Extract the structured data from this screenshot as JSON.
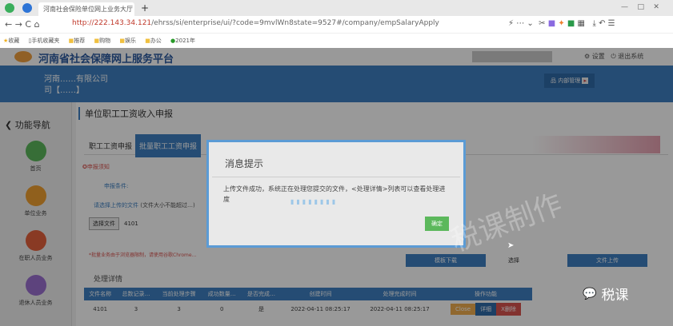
{
  "browser": {
    "tab_title": "河南社会保险单位网上业务大厅",
    "new_tab": "+",
    "url_host": "http://222.143.34.121",
    "url_path": "/ehrss/si/enterprise/ui/?code=9mvlWn8state=9527#/company/empSalaryApply",
    "bookmarks": [
      "收藏",
      "手机收藏夹",
      "推荐",
      "购物",
      "娱乐",
      "办公",
      "2021年"
    ],
    "window_controls": [
      "—",
      "□",
      "✕"
    ]
  },
  "site": {
    "title": "河南省社会保障网上服务平台",
    "header_links": [
      "设置",
      "退出系统"
    ],
    "company_name": "河南……有限公司",
    "company_line2": "司【……】",
    "menu_label": "内部管理"
  },
  "sidebar": {
    "title": "功能导航",
    "items": [
      {
        "label": "首页",
        "color": "#5cb85c"
      },
      {
        "label": "单位业务",
        "color": "#f0a030"
      },
      {
        "label": "在职人员业务",
        "color": "#e5603c"
      },
      {
        "label": "退休人员业务",
        "color": "#9b6fd0"
      }
    ]
  },
  "main": {
    "page_title": "单位职工工资收入申报",
    "tabs": [
      "职工工资申报",
      "批量职工工资申报"
    ],
    "notice": "申报须知",
    "condition_label": "申报条件:",
    "upload_label": "请选择上传的文件",
    "upload_hint": "(文件大小不能超过…)",
    "choose_file": "选择文件",
    "file_name": "4101",
    "browser_warning": "*批量业务由于浏览器限制，请使用谷歌Chrome…",
    "template_button": "模板下载",
    "select_label": "选择",
    "upload_button": "文件上传",
    "detail_title": "处理详情",
    "table": {
      "headers": [
        "文件名称",
        "总数记录…",
        "当前处理步骤",
        "成功数量…",
        "是否完成…",
        "创建时间",
        "处理完成时间",
        "操作功能"
      ],
      "rows": [
        {
          "cells": [
            "4101",
            "3",
            "3",
            "0",
            "是",
            "2022-04-11 08:25:17",
            "2022-04-11 08:25:17"
          ],
          "actions": [
            "Close",
            "详细",
            "X删除"
          ]
        }
      ]
    }
  },
  "modal": {
    "title": "消息提示",
    "message": "上传文件成功，系统正在处理您提交的文件，<处理详情>列表可以查看处理进度",
    "ok": "确定"
  },
  "watermark": {
    "text": "税课制作",
    "logo": "税课"
  }
}
